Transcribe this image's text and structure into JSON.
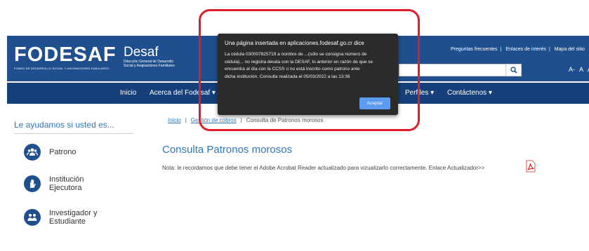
{
  "header": {
    "logo_text": "FODESAF",
    "logo_sub": "FONDO DE DESARROLLO SOCIAL Y ASIGNACIONES FAMILIARES",
    "desaf_name": "Desaf",
    "desaf_sub1": "Dirección General de Desarrollo",
    "desaf_sub2": "Social y Asignaciones Familiares",
    "toplinks": [
      "Preguntas frecuentes",
      "Enlaces de interés",
      "Mapa del sitio"
    ],
    "font_controls": [
      "A-",
      "A",
      "A+"
    ],
    "search_icon": "search-icon"
  },
  "nav": {
    "items": [
      "Inicio",
      "Acerca del Fodesaf ▾",
      "Perfiles ▾",
      "Contáctenos ▾"
    ]
  },
  "sidebar": {
    "title": "Le ayudamos si usted es...",
    "items": [
      {
        "label1": "Patrono",
        "label2": "",
        "icon": "group-icon"
      },
      {
        "label1": "Institución",
        "label2": "Ejecutora",
        "icon": "hand-icon"
      },
      {
        "label1": "Investigador y",
        "label2": "Estudiante",
        "icon": "people-icon"
      }
    ]
  },
  "breadcrumb": {
    "home": "Inicio",
    "section": "Gestión de cobros",
    "current": "Consulta de Patronos morosos",
    "separator": "|"
  },
  "main": {
    "title": "Consulta Patronos morosos",
    "note": "Nota: le recordamos que debe tener el Adobe Acrobat Reader actualizado para vizualizarlo correctamente.  Enlace Actualizador>>"
  },
  "dialog": {
    "title": "Una página insertada en aplicaciones.fodesaf.go.cr dice",
    "lines": [
      "La cédula 030007825719 a nombre de ...(sólo se consigna número de",
      "cédula)... no registra deuda con la DESAF, lo anterior en razón de que se",
      "encuentra al día con la CCSS o no está inscrito como patrono ante",
      "dicha institución. Consulta realizada el 05/03/2022 a las 13:36"
    ],
    "button": "Aceptar"
  },
  "colors": {
    "header": "#1f4f8f",
    "nav": "#17407a",
    "link": "#3276b9",
    "annotation": "#e21d2a",
    "dialog_bg": "#2b2b2b",
    "dialog_button": "#5b9cf0"
  }
}
